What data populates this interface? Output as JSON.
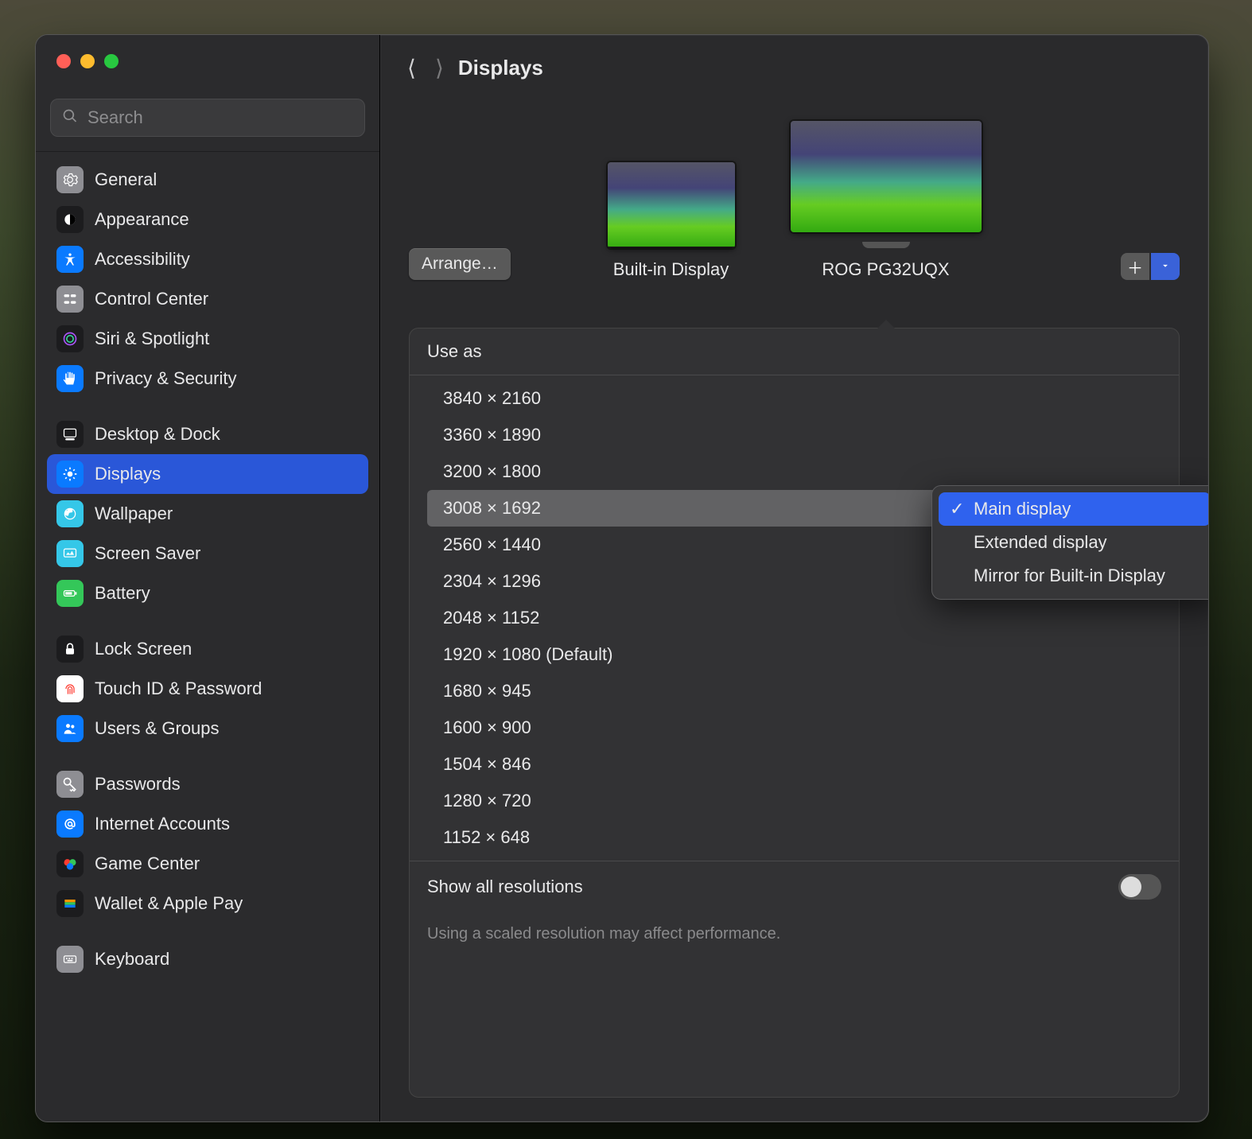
{
  "window_title": "Displays",
  "search": {
    "placeholder": "Search"
  },
  "nav": {
    "back_enabled": true,
    "forward_enabled": false
  },
  "sidebar": {
    "groups": [
      [
        {
          "label": "General",
          "icon": "gear",
          "bg": "#8e8e93"
        },
        {
          "label": "Appearance",
          "icon": "appearance",
          "bg": "#1c1c1e"
        },
        {
          "label": "Accessibility",
          "icon": "accessibility",
          "bg": "#0a7aff"
        },
        {
          "label": "Control Center",
          "icon": "control-center",
          "bg": "#8e8e93"
        },
        {
          "label": "Siri & Spotlight",
          "icon": "siri",
          "bg": "#1c1c1e"
        },
        {
          "label": "Privacy & Security",
          "icon": "hand",
          "bg": "#0a7aff"
        }
      ],
      [
        {
          "label": "Desktop & Dock",
          "icon": "dock",
          "bg": "#1c1c1e"
        },
        {
          "label": "Displays",
          "icon": "displays",
          "bg": "#0a7aff",
          "selected": true
        },
        {
          "label": "Wallpaper",
          "icon": "wallpaper",
          "bg": "#35c7e8"
        },
        {
          "label": "Screen Saver",
          "icon": "screensaver",
          "bg": "#35c7e8"
        },
        {
          "label": "Battery",
          "icon": "battery",
          "bg": "#34c759"
        }
      ],
      [
        {
          "label": "Lock Screen",
          "icon": "lock",
          "bg": "#1c1c1e"
        },
        {
          "label": "Touch ID & Password",
          "icon": "touchid",
          "bg": "#ffffff"
        },
        {
          "label": "Users & Groups",
          "icon": "users",
          "bg": "#0a7aff"
        }
      ],
      [
        {
          "label": "Passwords",
          "icon": "key",
          "bg": "#8e8e93"
        },
        {
          "label": "Internet Accounts",
          "icon": "at",
          "bg": "#0a7aff"
        },
        {
          "label": "Game Center",
          "icon": "gamecenter",
          "bg": "#1c1c1e"
        },
        {
          "label": "Wallet & Apple Pay",
          "icon": "wallet",
          "bg": "#1c1c1e"
        }
      ],
      [
        {
          "label": "Keyboard",
          "icon": "keyboard",
          "bg": "#8e8e93"
        }
      ]
    ]
  },
  "displays": {
    "arrange_label": "Arrange…",
    "items": [
      {
        "label": "Built-in Display",
        "type": "laptop"
      },
      {
        "label": "ROG PG32UQX",
        "type": "monitor",
        "selected": true
      }
    ],
    "add_label": "+",
    "use_as_label": "Use as",
    "use_as_menu": [
      {
        "label": "Main display",
        "checked": true
      },
      {
        "label": "Extended display"
      },
      {
        "label": "Mirror for Built-in Display"
      }
    ],
    "resolutions": [
      "3840 × 2160",
      "3360 × 1890",
      "3200 × 1800",
      "3008 × 1692",
      "2560 × 1440",
      "2304 × 1296",
      "2048 × 1152",
      "1920 × 1080 (Default)",
      "1680 × 945",
      "1600 × 900",
      "1504 × 846",
      "1280 × 720",
      "1152 × 648"
    ],
    "selected_resolution_index": 3,
    "show_all_label": "Show all resolutions",
    "show_all_on": false,
    "footer": "Using a scaled resolution may affect performance."
  }
}
